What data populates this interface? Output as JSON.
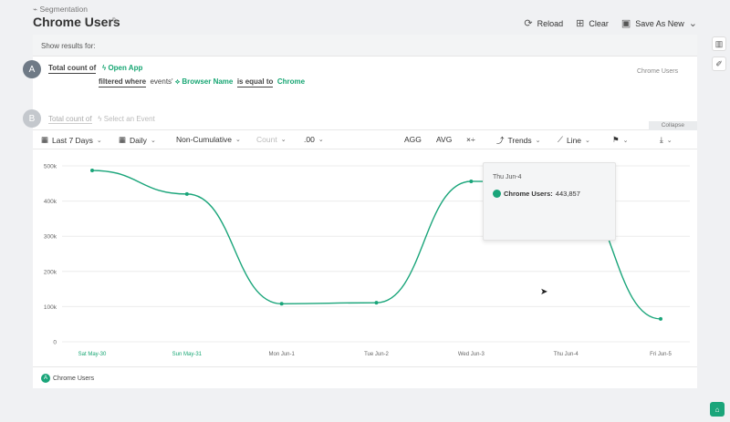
{
  "header": {
    "breadcrumb": "Segmentation",
    "title": "Chrome Users",
    "actions": {
      "reload": "Reload",
      "clear": "Clear",
      "save_as_new": "Save As New"
    }
  },
  "panel": {
    "show_results_for": "Show results for:",
    "query_a": {
      "badge": "A",
      "measure": "Total count of",
      "event": "Open App",
      "filtered_where": "filtered where",
      "events_label": "events'",
      "property": "Browser Name",
      "operator": "is equal to",
      "value": "Chrome",
      "segment_name": "Chrome Users"
    },
    "query_b": {
      "badge": "B",
      "measure": "Total count of",
      "placeholder": "Select an Event"
    },
    "collapse_label": "Collapse"
  },
  "toolbar": {
    "date_range": "Last 7 Days",
    "interval": "Daily",
    "cumulative": "Non-Cumulative",
    "count": "Count",
    "decimals": ".00",
    "agg": "AGG",
    "avg": "AVG",
    "trends": "Trends",
    "line": "Line"
  },
  "chart_data": {
    "type": "line",
    "categories": [
      "Sat May-30",
      "Sun May-31",
      "Mon Jun-1",
      "Tue Jun-2",
      "Wed Jun-3",
      "Thu Jun-4",
      "Fri Jun-5"
    ],
    "series": [
      {
        "name": "Chrome Users",
        "values": [
          487000,
          420000,
          108000,
          111000,
          456000,
          443857,
          65000
        ]
      }
    ],
    "ylim": [
      0,
      500000
    ],
    "y_ticks": [
      {
        "value": 0,
        "label": "0"
      },
      {
        "value": 100000,
        "label": "100k"
      },
      {
        "value": 200000,
        "label": "200k"
      },
      {
        "value": 300000,
        "label": "300k"
      },
      {
        "value": 400000,
        "label": "400k"
      },
      {
        "value": 500000,
        "label": "500k"
      }
    ],
    "weekend_label_color": "#17a673",
    "line_color": "#1aa57a",
    "grid": true
  },
  "tooltip": {
    "date": "Thu Jun-4",
    "series": "Chrome Users:",
    "value": "443,857"
  },
  "legend": {
    "badge": "A",
    "label": "Chrome Users"
  }
}
